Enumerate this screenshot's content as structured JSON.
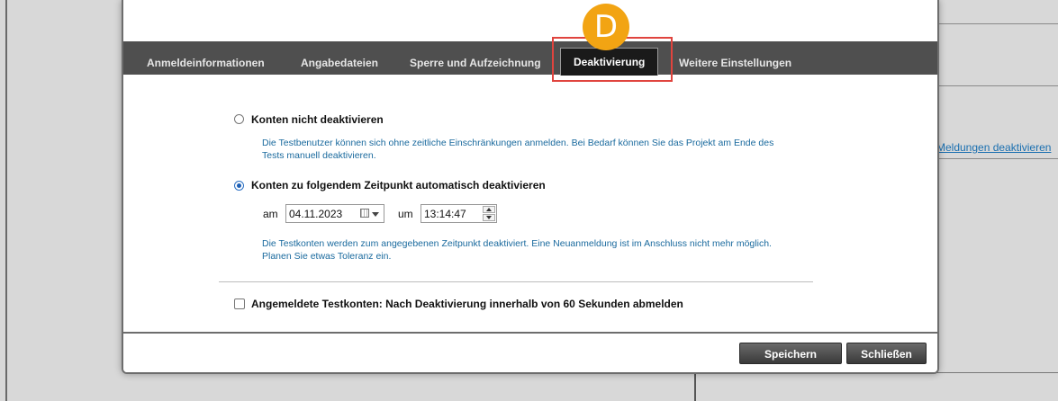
{
  "background": {
    "link_text": "Meldungen deaktivieren"
  },
  "badge": {
    "letter": "D",
    "color": "#f2a413"
  },
  "tabs": [
    {
      "label": "Anmeldeinformationen",
      "active": false
    },
    {
      "label": "Angabedateien",
      "active": false
    },
    {
      "label": "Sperre und Aufzeichnung",
      "active": false
    },
    {
      "label": "Deaktivierung",
      "active": true
    },
    {
      "label": "Weitere Einstellungen",
      "active": false
    }
  ],
  "options": {
    "no_deactivate": {
      "label": "Konten nicht deaktivieren",
      "checked": false,
      "help_line1": "Die Testbenutzer können sich ohne zeitliche Einschränkungen anmelden. Bei Bedarf können Sie das Projekt am Ende des",
      "help_line2": "Tests manuell deaktivieren."
    },
    "auto_deactivate": {
      "label": "Konten zu folgendem Zeitpunkt automatisch deaktivieren",
      "checked": true,
      "date_label": "am",
      "date_value": "04.11.2023",
      "time_label": "um",
      "time_value": "13:14:47",
      "help_line1": "Die Testkonten werden zum angegebenen Zeitpunkt deaktiviert. Eine Neuanmeldung ist im Anschluss nicht mehr möglich.",
      "help_line2": "Planen Sie etwas Toleranz ein."
    }
  },
  "logout_checkbox": {
    "label": "Angemeldete Testkonten: Nach Deaktivierung innerhalb von 60 Sekunden abmelden",
    "checked": false
  },
  "footer": {
    "save_label": "Speichern",
    "close_label": "Schließen"
  },
  "colors": {
    "highlight": "#e0443e",
    "help_text": "#1a6a9e",
    "tabbar": "#4f4f4f"
  }
}
